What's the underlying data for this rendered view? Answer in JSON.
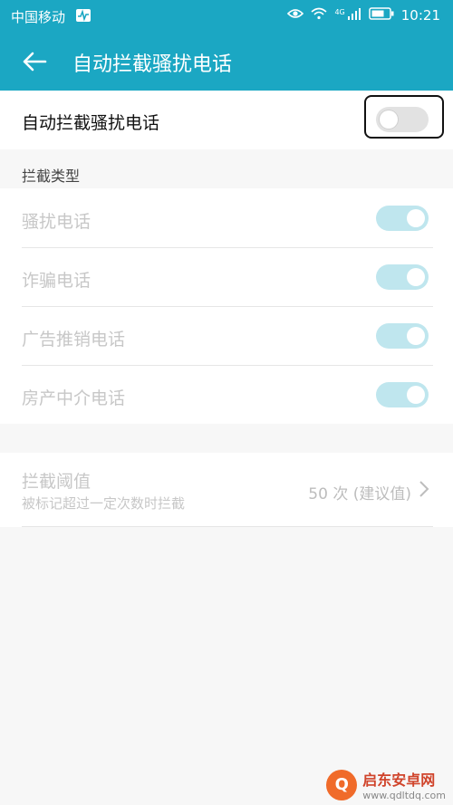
{
  "status": {
    "carrier": "中国移动",
    "network": "4G",
    "time": "10:21"
  },
  "header": {
    "title": "自动拦截骚扰电话"
  },
  "master": {
    "label": "自动拦截骚扰电话",
    "enabled": false
  },
  "section": {
    "title": "拦截类型"
  },
  "types": [
    {
      "label": "骚扰电话",
      "enabled": true
    },
    {
      "label": "诈骗电话",
      "enabled": true
    },
    {
      "label": "广告推销电话",
      "enabled": true
    },
    {
      "label": "房产中介电话",
      "enabled": true
    }
  ],
  "threshold": {
    "title": "拦截阈值",
    "subtitle": "被标记超过一定次数时拦截",
    "value": "50 次 (建议值)"
  },
  "watermark": {
    "logo_glyph": "Q",
    "brand": "启东安卓网",
    "url": "www.qdltdq.com"
  },
  "colors": {
    "accent": "#1ba7c3",
    "switch_on_disabled": "#bfe6ee",
    "switch_off": "#e2e2e2"
  }
}
